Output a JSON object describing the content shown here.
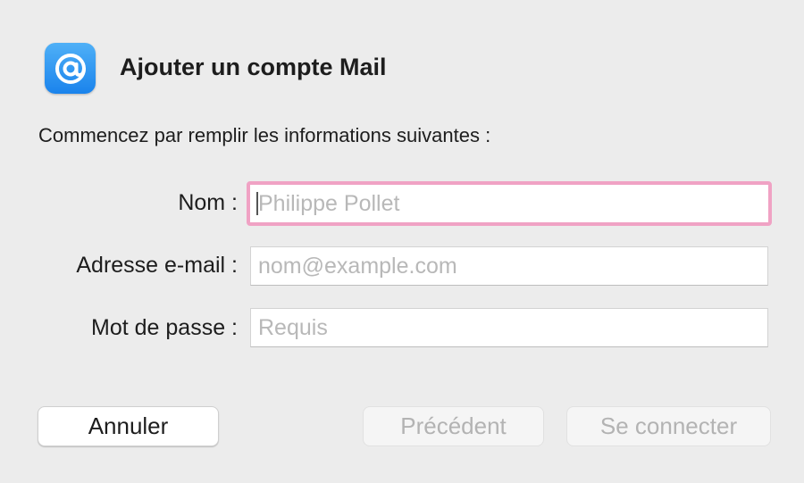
{
  "dialog": {
    "title": "Ajouter un compte Mail",
    "intro": "Commencez par remplir les informations suivantes :",
    "app_icon": "at-sign-icon",
    "accent_focus_color": "#f0a2c4"
  },
  "form": {
    "name": {
      "label": "Nom :",
      "value": "",
      "placeholder": "Philippe Pollet"
    },
    "email": {
      "label": "Adresse e-mail :",
      "value": "",
      "placeholder": "nom@example.com"
    },
    "password": {
      "label": "Mot de passe :",
      "value": "",
      "placeholder": "Requis"
    }
  },
  "buttons": {
    "cancel": "Annuler",
    "previous": "Précédent",
    "connect": "Se connecter"
  }
}
